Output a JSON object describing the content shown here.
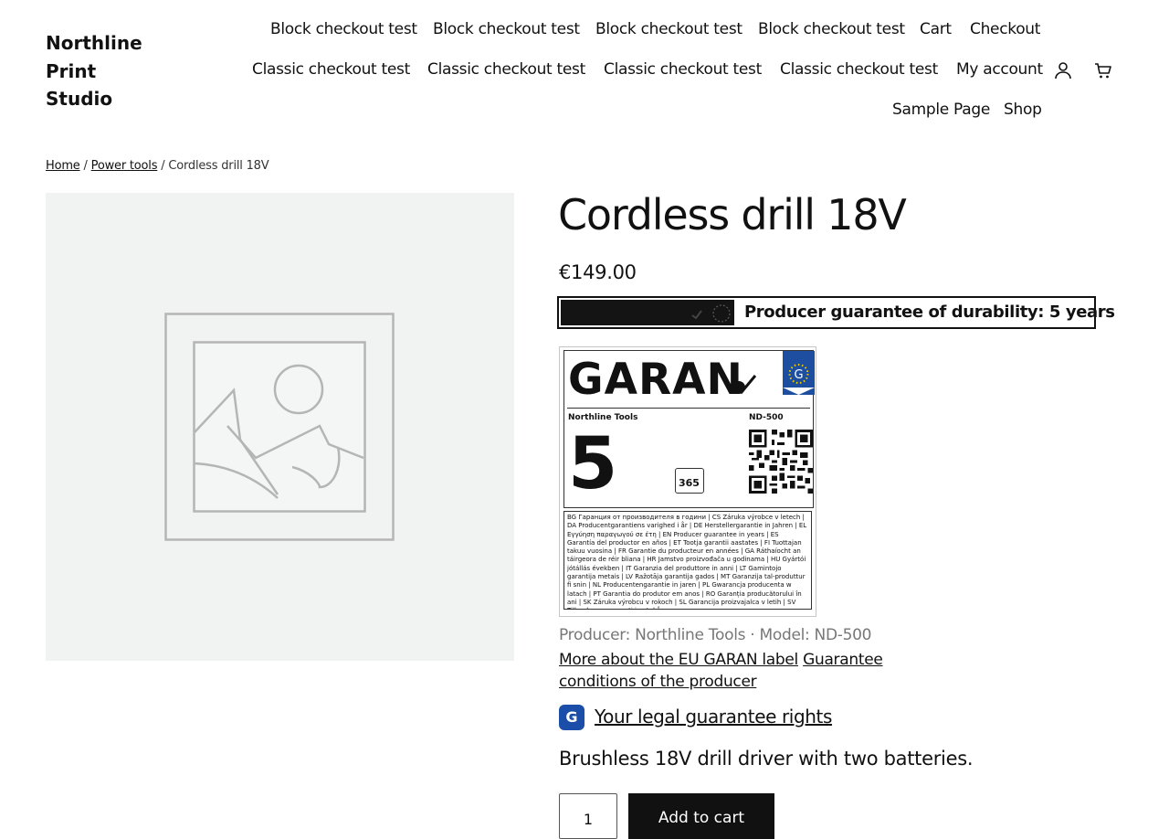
{
  "site": {
    "title": "Northline Print Studio"
  },
  "nav": {
    "row1": [
      "Block checkout test",
      "Block checkout test",
      "Block checkout test",
      "Block checkout test",
      "Cart",
      "Checkout"
    ],
    "row2": [
      "Classic checkout test",
      "Classic checkout test",
      "Classic checkout test",
      "Classic checkout test",
      "My account"
    ],
    "row3": [
      "Sample Page",
      "Shop"
    ],
    "icons": [
      "account-icon",
      "cart-icon"
    ]
  },
  "breadcrumb": {
    "home": "Home",
    "sep": "/",
    "category": "Power tools",
    "current": "Cordless drill 18V"
  },
  "product": {
    "title": "Cordless drill 18V",
    "price": "€149.00",
    "banner_text": "Producer guarantee of durability: 5 years",
    "label": {
      "brand_word": "GARAN",
      "producer": "Northline Tools",
      "model": "ND-500",
      "years": "5",
      "calendar": "365",
      "translations": "BG Гаранция от производителя в години | CS Záruka výrobce v letech | DA Producentgarantiens varighed i år | DE Herstellergarantie in Jahren | EL Εγγύηση παραγωγού σε έτη | EN Producer guarantee in years | ES Garantía del productor en años | ET Tootja garantii aastates | FI Tuottajan takuu vuosina | FR Garantie du producteur en années | GA Ráthaíocht an táirgeora de réir bliana | HR Jamstvo proizvođača u godinama | HU Gyártói jótállás években | IT Garanzia del produttore in anni | LT Gamintojo garantija metais | LV Ražotāja garantija gados | MT Garanzija tal-produttur fi snin | NL Producentengarantie in jaren | PL Gwarancja producenta w latach | PT Garantia do produtor em anos | RO Garanția producătorului în ani | SK Záruka výrobcu v rokoch | SL Garancija proizvajalca v letih | SV Tillverkarens garanti i antal år"
    },
    "meta": "Producer: Northline Tools · Model: ND-500",
    "link_more": "More about the EU GARAN label",
    "link_conditions": "Guarantee conditions of the producer",
    "badge_letter": "G",
    "rights_link": "Your legal guarantee rights",
    "description": "Brushless 18V drill driver with two batteries.",
    "quantity": "1",
    "add_to_cart": "Add to cart"
  },
  "colors": {
    "accent_blue": "#1a4ea8",
    "gallery_bg": "#f1f2f2",
    "dark": "#111111"
  }
}
